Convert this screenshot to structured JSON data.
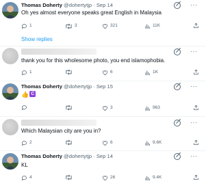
{
  "tweets": [
    {
      "author": "Thomas Doherty",
      "handle": "@dohertytjp",
      "sep": " · ",
      "date": "Sep 14",
      "text": "Oh yes almost everyone speaks great English in Malaysia",
      "replies": "1",
      "retweets": "3",
      "likes": "321",
      "views": "11K",
      "show_replies": "Show replies"
    },
    {
      "text": "thank you for this wholesome photo, you end islamophobia.",
      "replies": "1",
      "retweets": "",
      "likes": "6",
      "views": "1K"
    },
    {
      "author": "Thomas Doherty",
      "handle": "@dohertytjp",
      "sep": " · ",
      "date": "Sep 15",
      "emoji_thumb": "👍",
      "emoji_c": "C",
      "replies": "",
      "retweets": "",
      "likes": "3",
      "views": "963"
    },
    {
      "text": "Which Malaysian city are you in?",
      "replies": "2",
      "retweets": "",
      "likes": "6",
      "views": "9.6K"
    },
    {
      "author": "Thomas Doherty",
      "handle": "@dohertytjp",
      "sep": " · ",
      "date": "Sep 14",
      "text": "KL",
      "replies": "4",
      "retweets": "",
      "likes": "26",
      "views": "9.4K"
    }
  ],
  "icons": {
    "reply": "reply-icon",
    "retweet": "retweet-icon",
    "like": "heart-icon",
    "views": "views-icon",
    "share": "share-icon",
    "grok": "grok-icon",
    "more": "more-icon"
  },
  "colors": {
    "link": "#1d9bf0",
    "muted": "#536471",
    "text": "#0f1419"
  }
}
